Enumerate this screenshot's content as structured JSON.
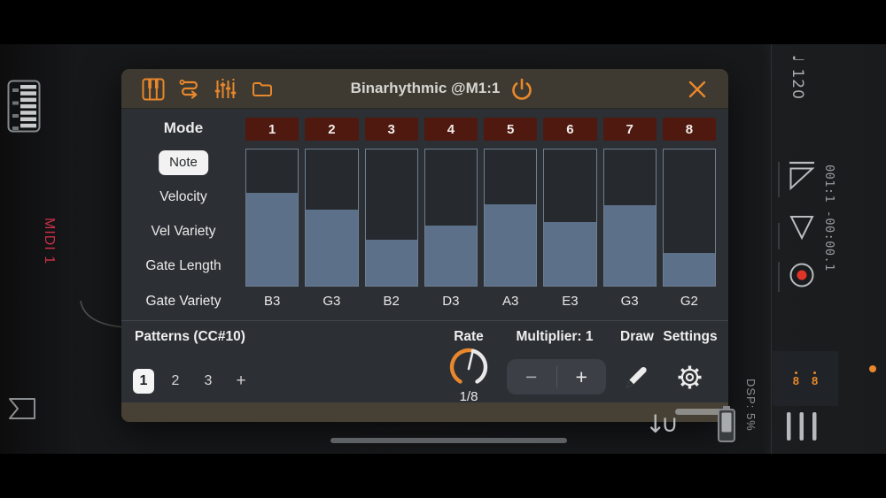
{
  "plugin": {
    "title": "Binarhythmic @M1:1",
    "mode": {
      "label": "Mode",
      "slots": [
        "1",
        "2",
        "3",
        "4",
        "5",
        "6",
        "7",
        "8"
      ]
    },
    "params": {
      "selected": "Note",
      "items": [
        "Note",
        "Velocity",
        "Vel Variety",
        "Gate Length",
        "Gate Variety"
      ]
    },
    "steps": [
      {
        "note": "B3",
        "value": 0.68
      },
      {
        "note": "G3",
        "value": 0.56
      },
      {
        "note": "B2",
        "value": 0.34
      },
      {
        "note": "D3",
        "value": 0.44
      },
      {
        "note": "A3",
        "value": 0.6
      },
      {
        "note": "E3",
        "value": 0.47
      },
      {
        "note": "G3",
        "value": 0.59
      },
      {
        "note": "G2",
        "value": 0.24
      }
    ],
    "patterns": {
      "label": "Patterns (CC#10)",
      "items": [
        "1",
        "2",
        "3"
      ],
      "selected": "1",
      "add": "+"
    },
    "rate": {
      "label": "Rate",
      "value": "1/8"
    },
    "multiplier": {
      "label": "Multiplier: 1",
      "minus": "−",
      "plus": "+"
    },
    "draw_label": "Draw",
    "settings_label": "Settings"
  },
  "left_rail": {
    "midi_label": "MIDI 1"
  },
  "right_rail": {
    "tempo_note": "♩",
    "tempo": "120",
    "timecode": "001:1 -00:00.1",
    "dsp": "DSP: 5%",
    "midi_jack_glyph": "8"
  },
  "icons": {
    "down_arrow": "↓",
    "magnet": "∪"
  },
  "colors": {
    "accent_orange": "#e8872c",
    "mode_red": "#4f190f",
    "bar_fill": "#5d7089",
    "record_red": "#e03428",
    "midi_red": "#c93048",
    "param_pill": "#f2f2f2"
  }
}
